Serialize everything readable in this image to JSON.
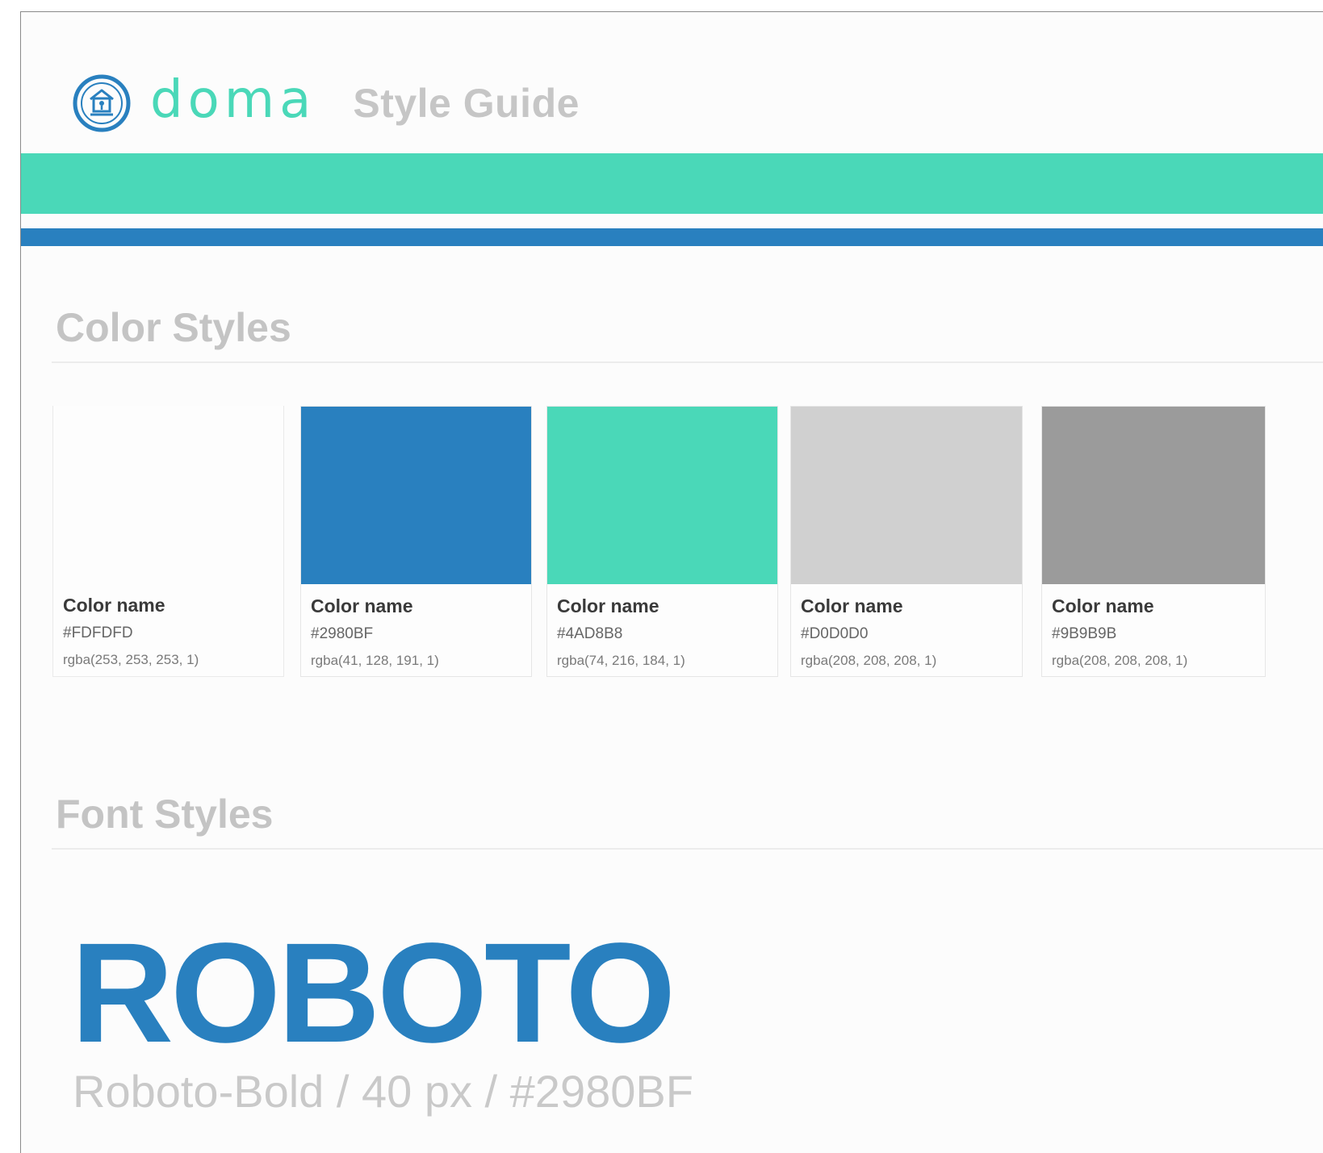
{
  "header": {
    "logo_icon": "house-in-circle-icon",
    "logo_wordmark": "doma",
    "title": "Style Guide"
  },
  "brand_colors": {
    "teal": "#4AD8B8",
    "blue": "#2980BF"
  },
  "color_styles": {
    "title": "Color Styles",
    "swatches": [
      {
        "name": "Color name",
        "hex": "#FDFDFD",
        "rgba": "rgba(253, 253, 253, 1)",
        "color": "#FDFDFD"
      },
      {
        "name": "Color name",
        "hex": "#2980BF",
        "rgba": "rgba(41, 128, 191, 1)",
        "color": "#2980BF"
      },
      {
        "name": "Color name",
        "hex": "#4AD8B8",
        "rgba": "rgba(74, 216, 184, 1)",
        "color": "#4AD8B8"
      },
      {
        "name": "Color name",
        "hex": "#D0D0D0",
        "rgba": "rgba(208, 208, 208, 1)",
        "color": "#D0D0D0"
      },
      {
        "name": "Color name",
        "hex": "#9B9B9B",
        "rgba": "rgba(208, 208, 208, 1)",
        "color": "#9B9B9B"
      }
    ]
  },
  "font_styles": {
    "title": "Font Styles",
    "sample": "ROBOTO",
    "spec": "Roboto-Bold / 40 px  / #2980BF"
  }
}
